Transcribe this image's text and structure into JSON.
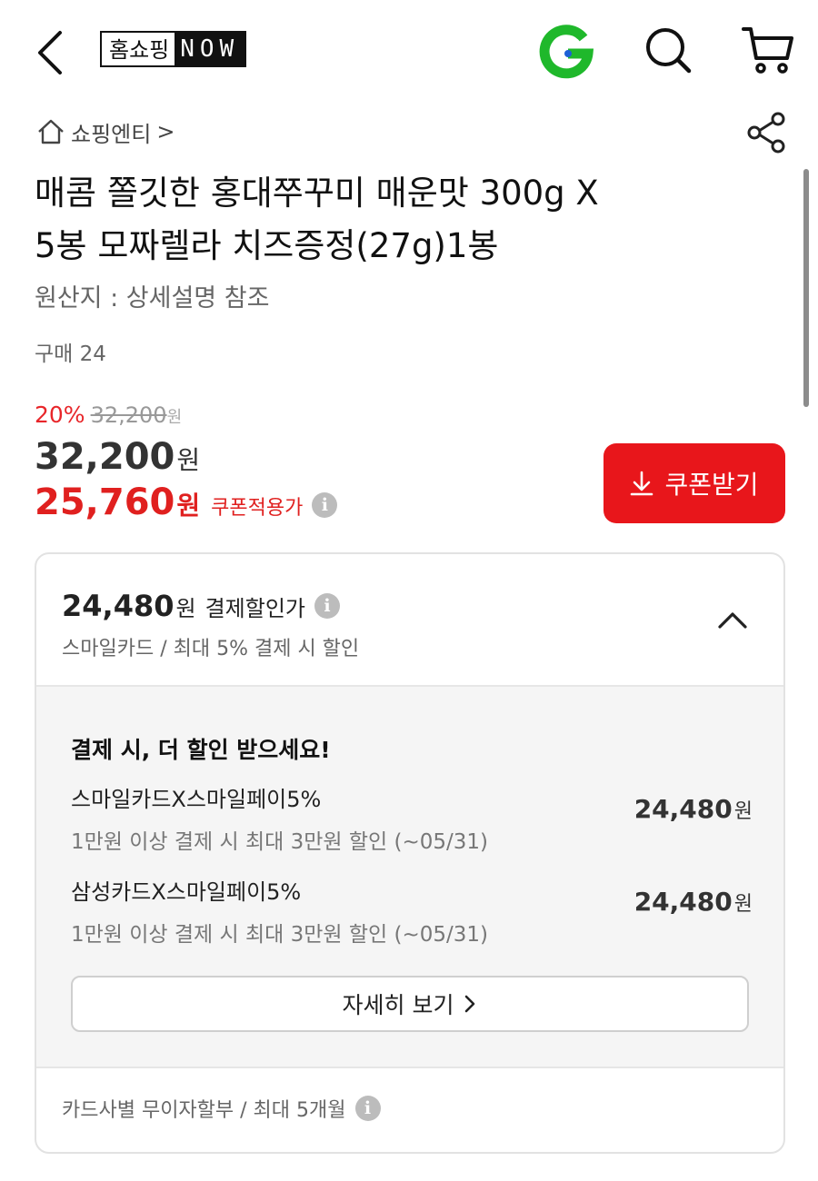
{
  "header": {
    "logo_text": "홈쇼핑",
    "logo_now": "NOW",
    "g_logo_color": "#1fb82b",
    "back_icon": "chevron-left-icon",
    "search_icon": "search-icon",
    "cart_icon": "cart-icon"
  },
  "breadcrumb": {
    "label": "쇼핑엔티",
    "separator": ">"
  },
  "product": {
    "title_line1": "매콤 쫄깃한 홍대쭈꾸미 매운맛 300g X",
    "title_line2": "5봉 모짜렐라 치즈증정(27g)1봉",
    "origin": "원산지 : 상세설명 참조",
    "purchase_count": "구매 24"
  },
  "price": {
    "discount_rate": "20%",
    "original_price": "32,200",
    "original_won": "원",
    "sale_price": "32,200",
    "sale_won": "원",
    "coupon_price": "25,760",
    "coupon_won": "원",
    "coupon_label": "쿠폰적용가",
    "info_glyph": "i",
    "accent_color": "#e8161b"
  },
  "coupon_button": {
    "label": "쿠폰받기"
  },
  "payment": {
    "price": "24,480",
    "won": "원",
    "label": "결제할인가",
    "sub": "스마일카드 / 최대 5% 결제 시 할인",
    "promo_title": "결제 시, 더 할인 받으세요!",
    "promos": [
      {
        "name": "스마일카드X스마일페이5%",
        "desc": "1만원 이상 결제 시 최대 3만원 할인 (~05/31)",
        "price": "24,480",
        "won": "원"
      },
      {
        "name": "삼성카드X스마일페이5%",
        "desc": "1만원 이상 결제 시 최대 3만원 할인 (~05/31)",
        "price": "24,480",
        "won": "원"
      }
    ],
    "details_label": "자세히 보기",
    "installment": "카드사별 무이자할부 / 최대 5개월"
  }
}
